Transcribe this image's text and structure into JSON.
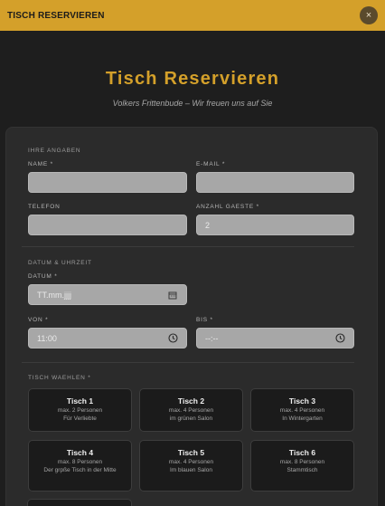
{
  "topbar": {
    "title": "TISCH RESERVIEREN",
    "close_label": "×"
  },
  "hero": {
    "title": "Tisch Reservieren",
    "subtitle": "Volkers Frittenbude – Wir freuen uns auf Sie"
  },
  "form": {
    "section_personal": "IHRE ANGABEN",
    "name_label": "NAME *",
    "email_label": "E-MAIL *",
    "phone_label": "TELEFON",
    "guests_label": "ANZAHL GAESTE *",
    "guests_value": "2",
    "section_datetime": "DATUM & UHRZEIT",
    "date_label": "DATUM *",
    "date_placeholder": "TT.mm.jjjj",
    "from_label": "VON *",
    "from_value": "11:00",
    "to_label": "BIS *",
    "to_value": "--:--",
    "section_table": "TISCH WAEHLEN *"
  },
  "tables": [
    {
      "name": "Tisch 1",
      "capacity": "max. 2 Personen",
      "desc": "Für Verliebte"
    },
    {
      "name": "Tisch 2",
      "capacity": "max. 4 Personen",
      "desc": "im grünen Salon"
    },
    {
      "name": "Tisch 3",
      "capacity": "max. 4 Personen",
      "desc": "In Wintergarten"
    },
    {
      "name": "Tisch 4",
      "capacity": "max. 8 Personen",
      "desc": "Der grpße Tisch in der Mitte"
    },
    {
      "name": "Tisch 5",
      "capacity": "max. 4 Personen",
      "desc": "Im blauen Salon"
    },
    {
      "name": "Tisch 6",
      "capacity": "max. 8 Personen",
      "desc": "Stammtisch"
    }
  ]
}
